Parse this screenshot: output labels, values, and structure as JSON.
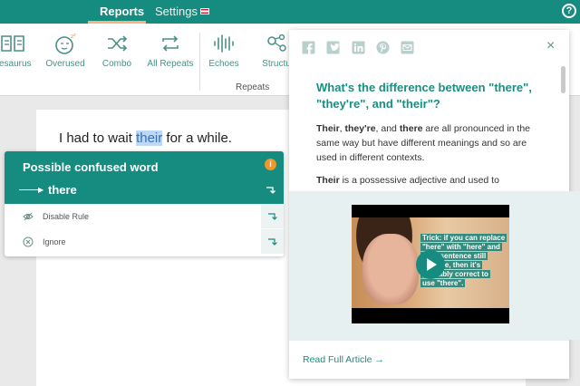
{
  "nav": {
    "reports_label": "Reports",
    "settings_label": "Settings",
    "help_glyph": "?"
  },
  "toolbar": {
    "tools": [
      {
        "label": "hesaurus",
        "icon": "book-icon"
      },
      {
        "label": "Overused",
        "icon": "sleepy-face-icon"
      },
      {
        "label": "Combo",
        "icon": "shuffle-icon"
      },
      {
        "label": "All Repeats",
        "icon": "repeat-icon"
      },
      {
        "label": "Echoes",
        "icon": "soundwave-icon"
      },
      {
        "label": "Structu",
        "icon": "network-icon"
      }
    ],
    "group_label": "Repeats"
  },
  "document": {
    "before": "I had to wait ",
    "highlight": "their",
    "after": " for a while."
  },
  "popup": {
    "title": "Possible confused word",
    "info_glyph": "i",
    "suggestion": "there",
    "rows": [
      {
        "label": "Disable Rule",
        "icon": "eye-off-icon"
      },
      {
        "label": "Ignore",
        "icon": "x-circle-icon"
      }
    ]
  },
  "panel": {
    "share_icons": [
      "facebook-icon",
      "twitter-icon",
      "linkedin-icon",
      "pinterest-icon",
      "email-icon"
    ],
    "close_glyph": "×",
    "title": "What's the difference between \"there\", \"they're\", and \"their\"?",
    "p1_b1": "Their",
    "p1_t1": ", ",
    "p1_b2": "they're",
    "p1_t2": ", and ",
    "p1_b3": "there",
    "p1_t3": " are all pronounced in the same way but have different meanings and so are used in different contexts.",
    "p2_b1": "Their",
    "p2_t1": " is a possessive adjective and used to",
    "video": {
      "trick_line1": "Trick: if you can replace",
      "trick_line2": "\"here\" with \"here\" and",
      "trick_line3": "your sentence still",
      "trick_line4": "s sense, then it's",
      "trick_line5": "probably correct to",
      "trick_line6": "use \"there\"."
    },
    "read_full": "Read Full Article →"
  },
  "colors": {
    "brand": "#168b80",
    "accent": "#f1962a",
    "highlight": "#bcd8f5"
  }
}
